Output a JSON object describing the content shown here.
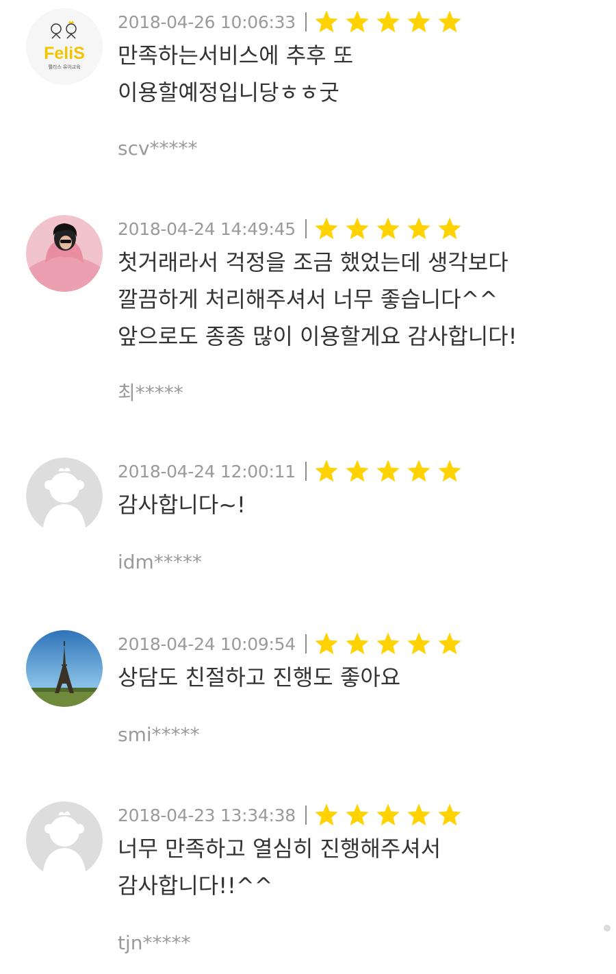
{
  "colors": {
    "star": "#FFD200",
    "date_text": "#9a9a9a",
    "body_text": "#333333",
    "username_text": "#9a9a9a",
    "avatar_placeholder": "#dddddd"
  },
  "reviews": [
    {
      "avatar": "felis-logo-avatar",
      "avatar_logo_text": "FeliS",
      "avatar_logo_subtext": "펠리스 유아교육",
      "date": "2018-04-26 10:06:33",
      "rating": 5,
      "lines": [
        "만족하는서비스에 추후 또",
        "이용할예정입니당ㅎㅎ굿"
      ],
      "username": "scv*****"
    },
    {
      "avatar": "person-pink-sweater-avatar",
      "date": "2018-04-24 14:49:45",
      "rating": 5,
      "lines": [
        "첫거래라서 걱정을 조금 했었는데 생각보다",
        "깔끔하게 처리해주셔서 너무 좋습니다^^",
        "앞으로도 종종 많이 이용할게요 감사합니다!"
      ],
      "username": "최*****"
    },
    {
      "avatar": "default-user-avatar",
      "date": "2018-04-24 12:00:11",
      "rating": 5,
      "lines": [
        "감사합니다~!"
      ],
      "username": "idm*****"
    },
    {
      "avatar": "eiffel-tower-avatar",
      "date": "2018-04-24 10:09:54",
      "rating": 5,
      "lines": [
        "상담도 친절하고 진행도 좋아요"
      ],
      "username": "smi*****"
    },
    {
      "avatar": "default-user-avatar",
      "date": "2018-04-23 13:34:38",
      "rating": 5,
      "lines": [
        "너무 만족하고 열심히 진행해주셔서",
        "감사합니다!!^^"
      ],
      "username": "tjn*****"
    }
  ]
}
